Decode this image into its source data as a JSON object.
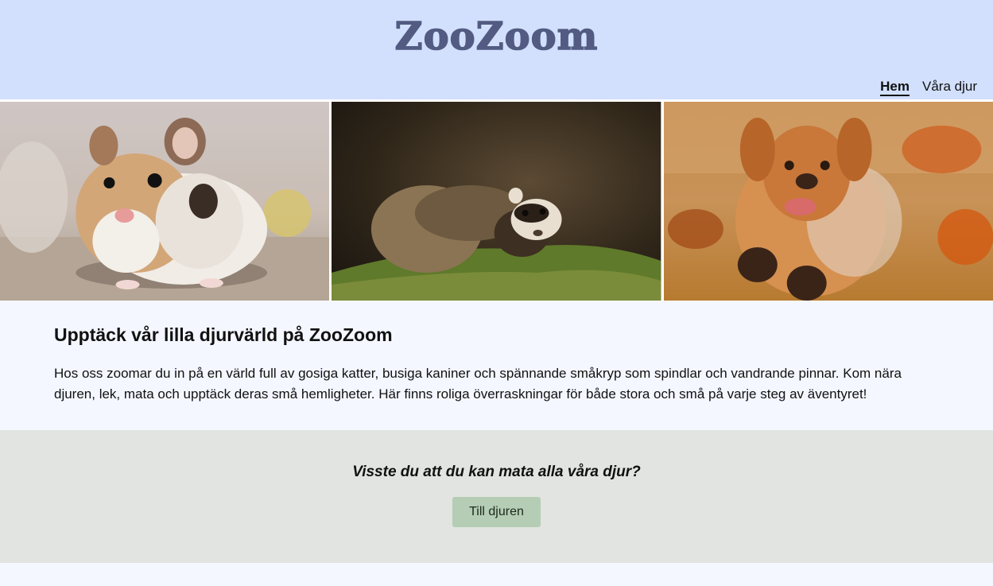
{
  "header": {
    "logo": "ZooZoom",
    "nav": [
      {
        "label": "Hem",
        "active": true
      },
      {
        "label": "Våra djur",
        "active": false
      }
    ]
  },
  "gallery": [
    {
      "subject": "hamster"
    },
    {
      "subject": "ferret"
    },
    {
      "subject": "golden retriever"
    }
  ],
  "intro": {
    "title": "Upptäck vår lilla djurvärld på ZooZoom",
    "body": "Hos oss zoomar du in på en värld full av gosiga katter, busiga kaniner och spännande småkryp som spindlar och vandrande pinnar. Kom nära djuren, lek, mata och upptäck deras små hemligheter. Här finns roliga överraskningar för både stora och små på varje steg av äventyret!"
  },
  "cta": {
    "question": "Visste du att du kan mata alla våra djur?",
    "button_label": "Till djuren"
  },
  "colors": {
    "header_bg": "#d2e0fd",
    "logo": "#535b82",
    "page_bg": "#f4f7ff",
    "cta_bg": "#e1e4e0",
    "button_bg": "#b5cdb4"
  }
}
